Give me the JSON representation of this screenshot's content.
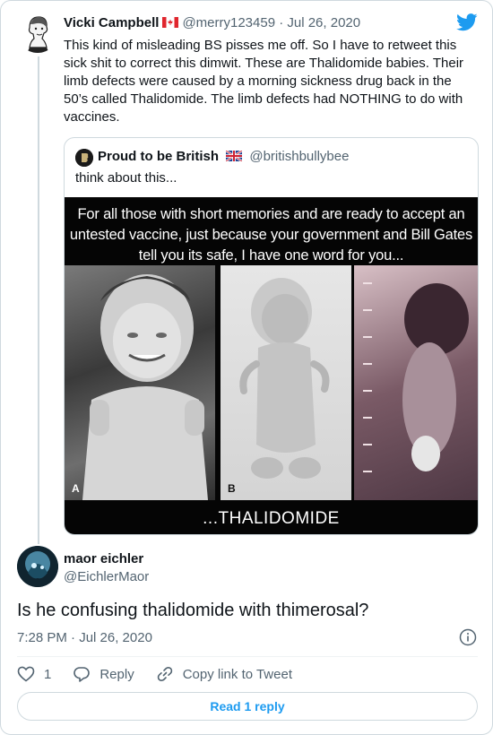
{
  "tweet1": {
    "author_name": "Vicki Campbell",
    "handle_date": "@merry123459 · Jul 26, 2020",
    "text": "This kind of misleading BS pisses me off. So I have to retweet this sick shit to correct this dimwit. These are Thalidomide babies. Their limb defects were caused by a morning sickness drug back in the 50’s called Thalidomide. The limb defects had NOTHING to do with vaccines."
  },
  "quote": {
    "author_name": "Proud to be British",
    "handle": "@britishbullybee",
    "text": "think about this...",
    "image_caption": "For all those with short memories and are ready to accept an untested vaccine, just because your government and Bill Gates tell you its safe, I have one word for you...",
    "photo_labels": [
      "A",
      "B"
    ],
    "image_bottom_text": "...THALIDOMIDE"
  },
  "tweet2": {
    "author_name": "maor eichler",
    "handle": "@EichlerMaor",
    "text": "Is he confusing thalidomide with thimerosal?",
    "timestamp": "7:28 PM · Jul 26, 2020"
  },
  "actions": {
    "like_count": "1",
    "reply_label": "Reply",
    "copy_label": "Copy link to Tweet"
  },
  "read_reply_label": "Read 1 reply",
  "colors": {
    "twitter_blue": "#1d9bf0",
    "secondary_text": "#536471",
    "border": "#cfd9de"
  },
  "icons": [
    "twitter-bird-icon",
    "canada-flag-icon",
    "uk-flag-icon",
    "info-icon",
    "heart-icon",
    "reply-icon",
    "link-icon"
  ]
}
